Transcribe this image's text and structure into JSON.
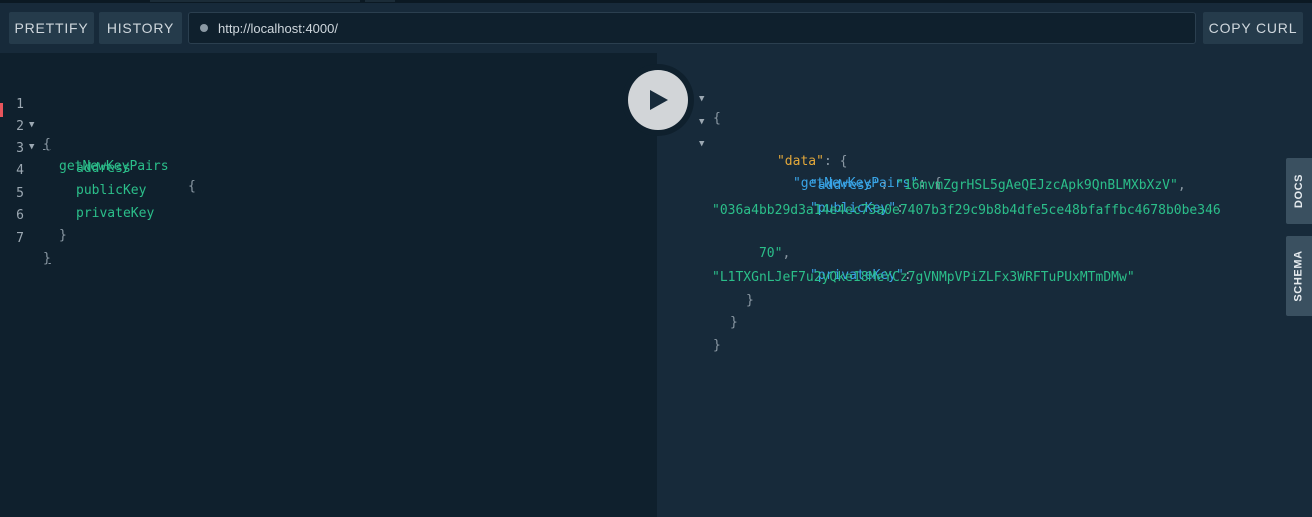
{
  "toolbar": {
    "prettify_label": "PRETTIFY",
    "history_label": "HISTORY",
    "url": "http://localhost:4000/",
    "copy_curl_label": "COPY CURL"
  },
  "editor": {
    "line_numbers": [
      "1",
      "2",
      "3",
      "4",
      "5",
      "6",
      "7"
    ],
    "lines": [
      "{",
      "getNewKeyPairs",
      "{",
      "address",
      "publicKey",
      "privateKey",
      "}",
      "}"
    ]
  },
  "result": {
    "open_brace": "{",
    "data_key": "\"data\"",
    "colon": ":",
    "comma": ",",
    "query_key": "\"getNewKeyPairs\"",
    "address_key": "\"address\"",
    "address_value": "\"16mvmZgrHSL5gAeQEJzcApk9QnBLMXbXzV\"",
    "public_key_key": "\"publicKey\"",
    "public_key_value_line1": "\"036a4bb29d3a14e4ec73a0e7407b3f29c9b8b4dfe5ce48bfaffbc4678b0be346",
    "public_key_value_line2": "70\"",
    "private_key_key": "\"privateKey\"",
    "private_key_value": "\"L1TXGnLJeF7u2yQke18MeYCz7gVNMpVPiZLFx3WRFTuPUxMTmDMw\"",
    "close_brace": "}"
  },
  "side_tabs": {
    "docs_label": "DOCS",
    "schema_label": "SCHEMA"
  }
}
